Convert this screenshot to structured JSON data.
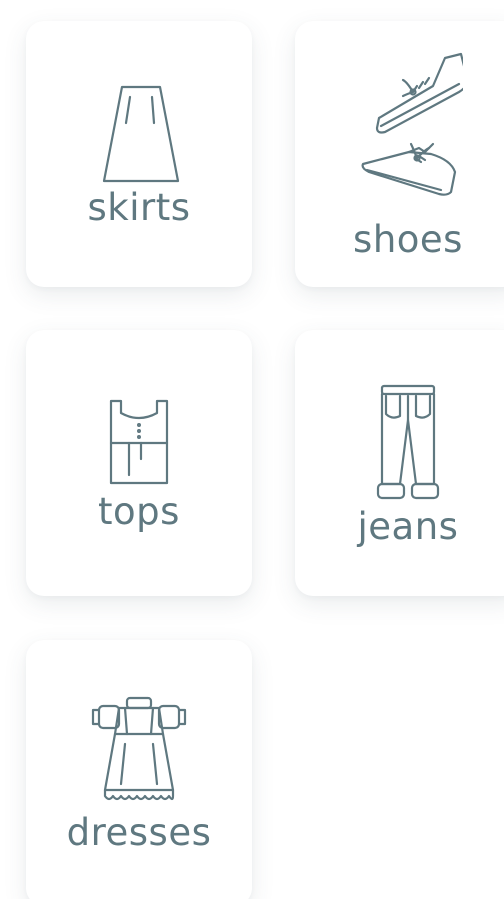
{
  "categories": [
    {
      "label": "skirts",
      "icon": "skirt-icon"
    },
    {
      "label": "shoes",
      "icon": "shoes-icon"
    },
    {
      "label": "tops",
      "icon": "top-icon"
    },
    {
      "label": "jeans",
      "icon": "jeans-icon"
    },
    {
      "label": "dresses",
      "icon": "dress-icon"
    }
  ],
  "colors": {
    "icon_and_text": "#5f7880",
    "card_background": "#ffffff"
  }
}
